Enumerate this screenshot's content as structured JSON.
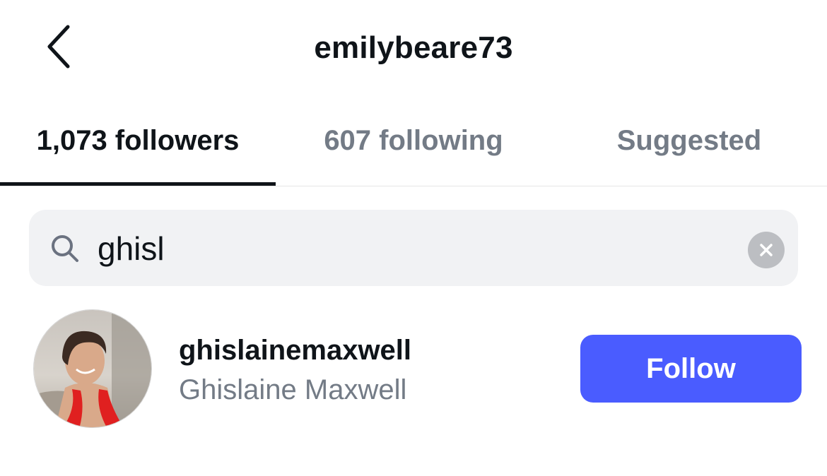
{
  "header": {
    "title": "emilybeare73",
    "back_icon": "chevron-left-icon"
  },
  "tabs": [
    {
      "label": "1,073 followers",
      "active": true
    },
    {
      "label": "607 following",
      "active": false
    },
    {
      "label": "Suggested",
      "active": false
    }
  ],
  "search": {
    "value": "ghisl",
    "icon": "search-icon",
    "clear_icon": "clear-icon"
  },
  "results": [
    {
      "username": "ghislainemaxwell",
      "full_name": "Ghislaine Maxwell",
      "action_label": "Follow"
    }
  ],
  "colors": {
    "follow_button": "#4a5cff",
    "search_background": "#f1f2f4",
    "secondary_text": "#737b86",
    "primary_text": "#0f1419"
  }
}
